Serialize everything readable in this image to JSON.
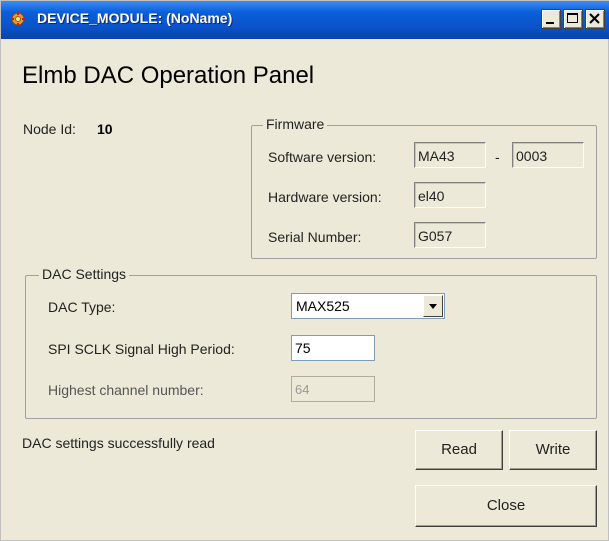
{
  "window": {
    "title": "DEVICE_MODULE: (NoName)",
    "accent_color": "#0a52c8",
    "icon": "gear-icon",
    "controls": {
      "minimize": "minimize-icon",
      "maximize": "maximize-icon",
      "close": "close-icon"
    }
  },
  "panel": {
    "heading": "Elmb DAC Operation Panel",
    "node_label": "Node Id:",
    "node_value": "10"
  },
  "firmware": {
    "legend": "Firmware",
    "software_label": "Software version:",
    "software_value_1": "MA43",
    "software_separator": "-",
    "software_value_2": "0003",
    "hardware_label": "Hardware version:",
    "hardware_value": "el40",
    "serial_label": "Serial Number:",
    "serial_value": "G057"
  },
  "dac_settings": {
    "legend": "DAC Settings",
    "type_label": "DAC Type:",
    "type_value": "MAX525",
    "spi_label": "SPI SCLK Signal High Period:",
    "spi_value": "75",
    "highest_label": "Highest channel number:",
    "highest_value": "64"
  },
  "status": {
    "text": "DAC settings successfully read"
  },
  "buttons": {
    "read": "Read",
    "write": "Write",
    "close": "Close"
  }
}
